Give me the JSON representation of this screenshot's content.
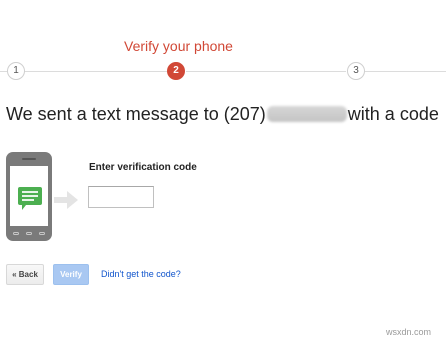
{
  "steps": {
    "current_title": "Verify your phone",
    "items": [
      {
        "number": "1",
        "state": "inactive"
      },
      {
        "number": "2",
        "state": "active"
      },
      {
        "number": "3",
        "state": "inactive"
      }
    ]
  },
  "heading": {
    "prefix": "We sent a text message to (207)",
    "suffix": "with a code"
  },
  "form": {
    "code_label": "Enter verification code",
    "code_value": ""
  },
  "buttons": {
    "back_label": "« Back",
    "verify_label": "Verify"
  },
  "links": {
    "no_code": "Didn't get the code?"
  },
  "watermark": "wsxdn.com",
  "colors": {
    "accent_red": "#d14836",
    "link_blue": "#1155cc",
    "verify_disabled_blue": "#a9c8f2",
    "message_green": "#4caf50",
    "phone_gray": "#7a7a7a"
  },
  "icons": {
    "phone": "smartphone-message-icon",
    "arrow": "right-arrow-icon"
  }
}
